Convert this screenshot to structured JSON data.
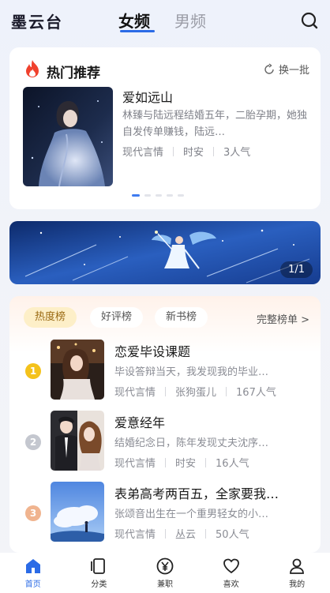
{
  "header": {
    "app_name": "墨云台",
    "tabs": [
      {
        "label": "女频",
        "active": true
      },
      {
        "label": "男频",
        "active": false
      }
    ],
    "search_icon": "search-icon"
  },
  "hot": {
    "title": "热门推荐",
    "refresh_label": "换一批",
    "book": {
      "title": "爱如远山",
      "description": "林臻与陆远程结婚五年，二胎孕期，她独自发传单赚钱，陆远…",
      "genre": "现代言情",
      "author": "时安",
      "popularity": "3人气"
    },
    "carousel_pages": 5,
    "carousel_active": 0
  },
  "banner": {
    "counter": "1/1"
  },
  "ranking": {
    "chips": [
      {
        "label": "热度榜",
        "active": true
      },
      {
        "label": "好评榜",
        "active": false
      },
      {
        "label": "新书榜",
        "active": false
      }
    ],
    "full_list_label": "完整榜单 >",
    "items": [
      {
        "rank": "1",
        "title": "恋爱毕设课题",
        "description": "毕设答辩当天，我发现我的毕业…",
        "genre": "现代言情",
        "author": "张狗蛋儿",
        "popularity": "167人气",
        "rank_color": "#f4c21b"
      },
      {
        "rank": "2",
        "title": "爱意经年",
        "description": "结婚纪念日，陈年发现丈夫沈序…",
        "genre": "现代言情",
        "author": "时安",
        "popularity": "16人气",
        "rank_color": "#c4c7cf"
      },
      {
        "rank": "3",
        "title": "表弟高考两百五，全家要我…",
        "description": "张颂音出生在一个重男轻女的小…",
        "genre": "现代言情",
        "author": "丛云",
        "popularity": "50人气",
        "rank_color": "#f0b48f"
      }
    ]
  },
  "bottom_nav": [
    {
      "label": "首页",
      "icon": "home-icon",
      "active": true
    },
    {
      "label": "分类",
      "icon": "category-icon",
      "active": false
    },
    {
      "label": "兼职",
      "icon": "yen-icon",
      "active": false
    },
    {
      "label": "喜欢",
      "icon": "heart-icon",
      "active": false
    },
    {
      "label": "我的",
      "icon": "profile-icon",
      "active": false
    }
  ],
  "colors": {
    "accent": "#2b6be6",
    "hot_chip_bg": "#fdefc8",
    "text_secondary": "#7f8189"
  }
}
